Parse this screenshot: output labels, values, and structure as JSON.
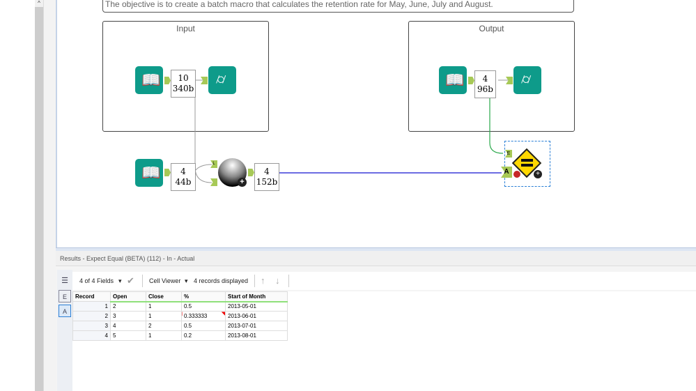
{
  "canvas": {
    "description": "The objective is to create a batch macro that calculates the retention rate for May, June, July and August.",
    "containers": [
      {
        "title": "Input"
      },
      {
        "title": "Output"
      }
    ],
    "input_stats": {
      "records": "10",
      "size": "340b"
    },
    "lower_stats": {
      "records": "4",
      "size": "44b"
    },
    "join_stats": {
      "records": "4",
      "size": "152b"
    },
    "output_stats": {
      "records": "4",
      "size": "96b"
    },
    "anchors": {
      "expected": "E",
      "actual": "A",
      "join_top": "L"
    },
    "colors": {
      "tool": "#0e9b8a",
      "anchor": "#a7c957",
      "blue_line": "#3b3bd9",
      "green_line": "#2aa84a",
      "test_tool": "#ffd800"
    }
  },
  "results": {
    "title": "Results - Expect Equal (BETA) (112) - In - Actual",
    "fields_label": "4 of 4 Fields",
    "viewer_label": "Cell Viewer",
    "records_label": "4 records displayed",
    "side_icons": {
      "expected": "E",
      "actual": "A"
    },
    "columns": [
      "Record",
      "Open",
      "Close",
      "%",
      "Start of Month"
    ],
    "rows": [
      [
        "1",
        "2",
        "1",
        "0.5",
        "2013-05-01"
      ],
      [
        "2",
        "3",
        "1",
        "0.333333",
        "2013-06-01"
      ],
      [
        "3",
        "4",
        "2",
        "0.5",
        "2013-07-01"
      ],
      [
        "4",
        "5",
        "1",
        "0.2",
        "2013-08-01"
      ]
    ]
  }
}
